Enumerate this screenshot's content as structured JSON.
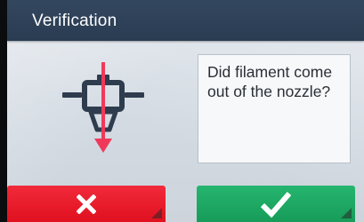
{
  "title_bar": {
    "title": "Verification"
  },
  "dialog": {
    "question": "Did filament come out of the nozzle?"
  },
  "buttons": {
    "no_icon": "close-x-icon",
    "yes_icon": "checkmark-icon"
  },
  "colors": {
    "title_bar": "#2f435a",
    "no_button": "#e8192a",
    "yes_button": "#1fa862",
    "arrow": "#f0395a",
    "nozzle": "#2e3c4e"
  }
}
